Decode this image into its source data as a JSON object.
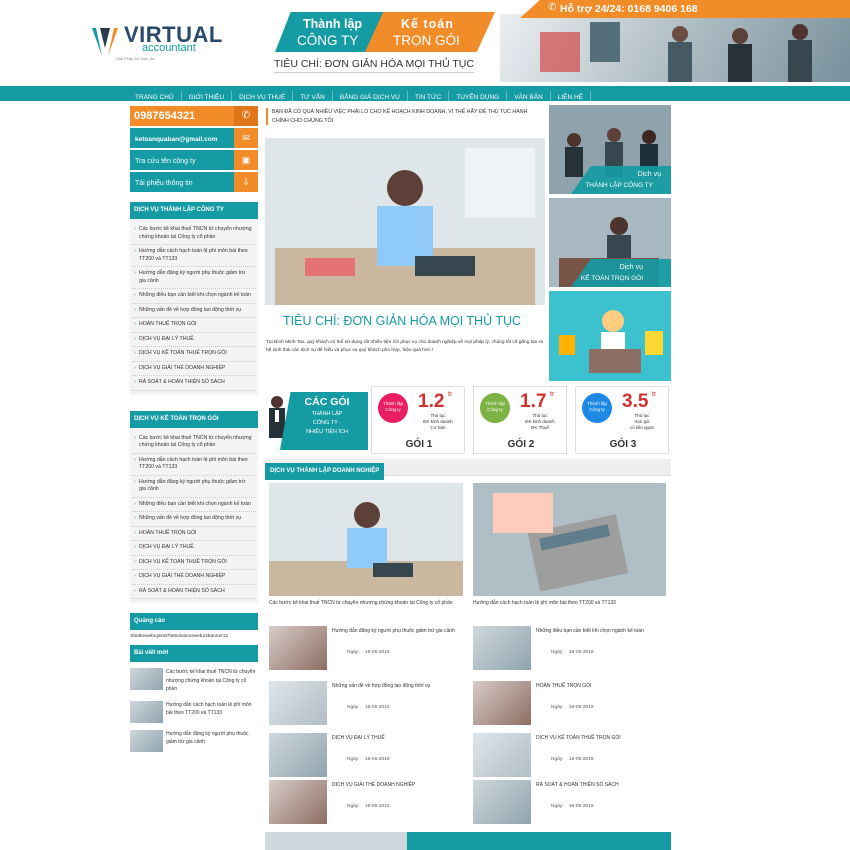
{
  "brand": {
    "name": "VIRTUAL",
    "sub": "accountant",
    "tag": "Giải Pháp Kế toán Ảo"
  },
  "header": {
    "hotline": "Hỗ trợ 24/24: 0168 9406 168",
    "banner1_top": "Thành lập",
    "banner1_bot": "CÔNG TY",
    "banner2_top": "Kế toán",
    "banner2_bot": "TRỌN GÓI",
    "criteria": "TIÊU CHÍ: ĐƠN GIẢN HÓA MỌI THỦ TỤC"
  },
  "nav": [
    "TRANG CHỦ",
    "GIỚI THIỆU",
    "DỊCH VỤ THUẾ",
    "TƯ VẤN",
    "BẢNG GIÁ DỊCH VỤ",
    "TIN TỨC",
    "TUYỂN DỤNG",
    "VĂN BẢN",
    "LIÊN HỆ"
  ],
  "contact": [
    "0987654321",
    "ketoanquaban@gmail.com",
    "Tra cứu tên công ty",
    "Tải phiếu thông tin"
  ],
  "side1": {
    "title": "DỊCH VỤ THÀNH LẬP CÔNG TY",
    "items": [
      "Các bước kê khai thuế TNCN từ chuyển nhượng chứng khoán tại Công ty cổ phần",
      "Hướng dẫn cách hạch toán lệ phí môn bài theo TT200 và TT133",
      "Hướng dẫn đăng ký người phụ thuộc giảm trừ gia cảnh",
      "Những điều bạn cần biết khi chọn ngành kế toán",
      "Những vấn đề về hợp đồng lao động thời vụ",
      "HOÀN THUẾ TRỌN GÓI",
      "DỊCH VỤ ĐẠI LÝ THUẾ",
      "DỊCH VỤ KẾ TOÁN THUẾ TRỌN GÓI",
      "DỊCH VỤ GIẢI THỂ DOANH NGHIỆP",
      "RÀ SOÁT & HOÀN THIỆN SỔ SÁCH"
    ]
  },
  "side2": {
    "title": "DỊCH VỤ KẾ TOÁN TRỌN GÓI",
    "items": [
      "Các bước kê khai thuế TNCN từ chuyển nhượng chứng khoán tại Công ty cổ phần",
      "Hướng dẫn cách hạch toán lệ phí môn bài theo TT200 và TT133",
      "Hướng dẫn đăng ký người phụ thuộc giảm trừ gia cảnh",
      "Những điều bạn cần biết khi chọn ngành kế toán",
      "Những vấn đề về hợp đồng lao động thời vụ",
      "HOÀN THUẾ TRỌN GÓI",
      "DỊCH VỤ ĐẠI LÝ THUẾ",
      "DỊCH VỤ KẾ TOÁN THUẾ TRỌN GÓI",
      "DỊCH VỤ GIẢI THỂ DOANH NGHIỆP",
      "RÀ SOÁT & HOÀN THIỆN SỔ SÁCH"
    ]
  },
  "ads": {
    "title": "Quảng cáo",
    "text": "thietkewebuytin07tatsolutionsweb24banner12"
  },
  "recent": {
    "title": "Bài viết mới",
    "items": [
      "Các bước kê khai thuế TNCN từ chuyển nhượng chứng khoán tại Công ty cổ phần",
      "Hướng dẫn cách hạch toán lệ phí môn bài theo TT200 và TT133",
      "Hướng dẫn đăng ký người phụ thuộc giảm trừ gia cảnh"
    ]
  },
  "intro": {
    "text": "BẠN ĐÃ CÓ QUÁ NHIỀU VIỆC PHẢI LO CHO KẾ HOẠCH KINH DOANH, VÌ THẾ HÃY ĐỂ THỦ TỤC HÀNH CHÍNH CHO CHÚNG TÔI",
    "heading": "TIÊU CHÍ: ĐƠN GIẢN HÓA MỌI THỦ TỤC",
    "body": "Tại Bình Minh Tax, quý khách có thể sử dụng rất nhiều tiện ích phục vụ cho doanh nghiệp về mọi pháp lý, chúng tôi cố gắng tạo ra hệ sinh thái các dịch vụ để hiểu và phục vụ quý khách phù hợp, hiệu quả hơn !"
  },
  "services": [
    {
      "top": "Dịch vụ",
      "bot": "THÀNH LẬP CÔNG TY"
    },
    {
      "top": "Dịch vụ",
      "bot": "KẾ TOÁN TRỌN GÓI"
    }
  ],
  "packages": {
    "promo_title": "CÁC GÓI",
    "promo_sub1": "THÀNH LẬP",
    "promo_sub2": "CÔNG TY -",
    "promo_sub3": "NHIỀU TIỆN ÍCH",
    "items": [
      {
        "circle": "Thành lập Công ty",
        "price": "1.2",
        "unit": "tr",
        "desc": "Thủ tục\nĐK kinh doanh\nCơ bản",
        "name": "GÓI 1",
        "color": "#e91e63"
      },
      {
        "circle": "Thành lập Công ty",
        "price": "1.7",
        "unit": "tr",
        "desc": "Thủ tục\nĐK kinh doanh\nĐK Thuế",
        "name": "GÓI 2",
        "color": "#7cb342"
      },
      {
        "circle": "Thành lập Công ty",
        "price": "3.5",
        "unit": "tr",
        "desc": "Thủ tục\ntrọn gói\ncó liên quan",
        "name": "GÓI 3",
        "color": "#1e88e5"
      }
    ]
  },
  "section": {
    "title": "DỊCH VỤ THÀNH LẬP DOANH NGHIỆP",
    "featured": [
      "Các bước kê khai thuế TNCN từ chuyển nhượng chứng khoán tại Công ty cổ phần",
      "Hướng dẫn cách hạch toán lệ phí môn bài theo TT200 và TT133"
    ],
    "date_label": "Ngày:",
    "posts": [
      {
        "title": "Hướng dẫn đăng ký người phụ thuộc giảm trừ gia cảnh",
        "date": "16-05-2019"
      },
      {
        "title": "Những điều bạn cần biết khi chọn ngành kế toán",
        "date": "16-05-2019"
      },
      {
        "title": "Những vấn đề về hợp đồng lao động thời vụ",
        "date": "16-05-2019"
      },
      {
        "title": "HOÀN THUẾ TRỌN GÓI",
        "date": "16-05-2019"
      },
      {
        "title": "DỊCH VỤ ĐẠI LÝ THUẾ",
        "date": "16-05-2019"
      },
      {
        "title": "DỊCH VỤ KẾ TOÁN THUẾ TRỌN GÓI",
        "date": "16-05-2019"
      },
      {
        "title": "DỊCH VỤ GIẢI THỂ DOANH NGHIỆP",
        "date": "16-05-2019"
      },
      {
        "title": "RÀ SOÁT & HOÀN THIỆN SỔ SÁCH",
        "date": "16-05-2019"
      }
    ]
  },
  "colors": {
    "teal": "#149ba3",
    "orange": "#f28c28"
  }
}
